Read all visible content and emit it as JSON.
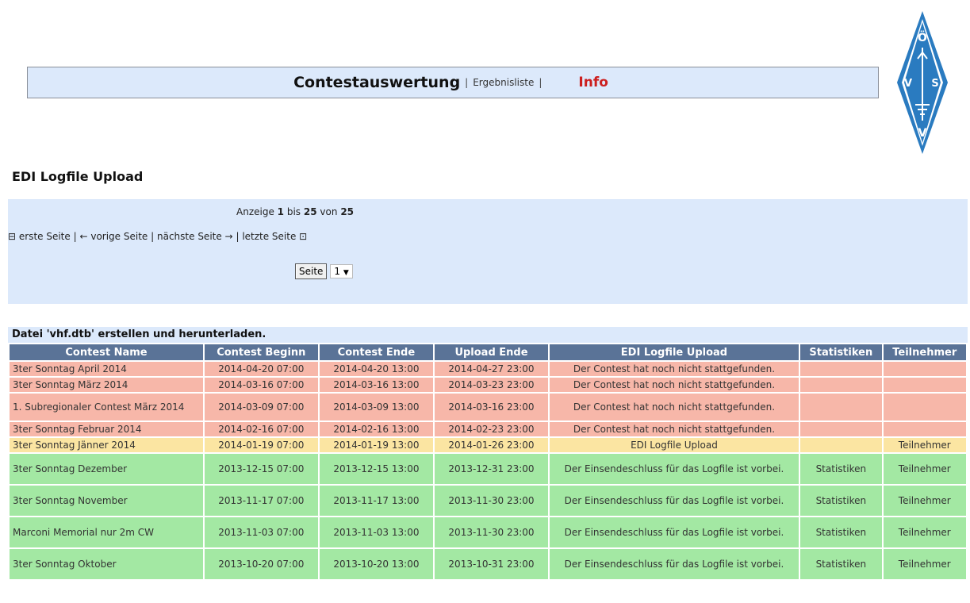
{
  "header": {
    "main": "Contestauswertung",
    "sep1": "|",
    "ergebnisliste": "Ergebnisliste",
    "sep2": "|",
    "info": "Info",
    "logo_text": "ÖVSV"
  },
  "page_title": "EDI Logfile Upload",
  "pager": {
    "anzeige": "Anzeige",
    "from": "1",
    "bis": "bis",
    "to": "25",
    "von": "von",
    "total": "25",
    "first": "⊟ erste Seite",
    "sep": "|",
    "prev": "← vorige Seite",
    "next": "nächste Seite →",
    "last": "letzte Seite ⊡",
    "seite_button": "Seite",
    "selected_page": "1",
    "dropdown_arrow": "▼"
  },
  "download_text": "Datei 'vhf.dtb' erstellen und herunterladen.",
  "table": {
    "headers": [
      "Contest Name",
      "Contest Beginn",
      "Contest Ende",
      "Upload Ende",
      "EDI Logfile Upload",
      "Statistiken",
      "Teilnehmer"
    ],
    "rows": [
      {
        "name": "3ter Sonntag April 2014",
        "beginn": "2014-04-20 07:00",
        "ende": "2014-04-20 13:00",
        "upload": "2014-04-27 23:00",
        "status": "Der Contest hat noch nicht stattgefunden.",
        "stat": "",
        "teil": ""
      },
      {
        "name": "3ter Sonntag März 2014",
        "beginn": "2014-03-16 07:00",
        "ende": "2014-03-16 13:00",
        "upload": "2014-03-23 23:00",
        "status": "Der Contest hat noch nicht stattgefunden.",
        "stat": "",
        "teil": ""
      },
      {
        "name": "1. Subregionaler Contest März 2014",
        "beginn": "2014-03-09 07:00",
        "ende": "2014-03-09 13:00",
        "upload": "2014-03-16 23:00",
        "status": "Der Contest hat noch nicht stattgefunden.",
        "stat": "",
        "teil": ""
      },
      {
        "name": "3ter Sonntag Februar 2014",
        "beginn": "2014-02-16 07:00",
        "ende": "2014-02-16 13:00",
        "upload": "2014-02-23 23:00",
        "status": "Der Contest hat noch nicht stattgefunden.",
        "stat": "",
        "teil": ""
      },
      {
        "name": "3ter Sonntag Jänner 2014",
        "beginn": "2014-01-19 07:00",
        "ende": "2014-01-19 13:00",
        "upload": "2014-01-26 23:00",
        "status": "EDI Logfile Upload",
        "stat": "",
        "teil": "Teilnehmer"
      },
      {
        "name": "3ter Sonntag Dezember",
        "beginn": "2013-12-15 07:00",
        "ende": "2013-12-15 13:00",
        "upload": "2013-12-31 23:00",
        "status": "Der Einsendeschluss für das Logfile ist vorbei.",
        "stat": "Statistiken",
        "teil": "Teilnehmer"
      },
      {
        "name": "3ter Sonntag November",
        "beginn": "2013-11-17 07:00",
        "ende": "2013-11-17 13:00",
        "upload": "2013-11-30 23:00",
        "status": "Der Einsendeschluss für das Logfile ist vorbei.",
        "stat": "Statistiken",
        "teil": "Teilnehmer"
      },
      {
        "name": "Marconi Memorial nur 2m CW",
        "beginn": "2013-11-03 07:00",
        "ende": "2013-11-03 13:00",
        "upload": "2013-11-30 23:00",
        "status": "Der Einsendeschluss für das Logfile ist vorbei.",
        "stat": "Statistiken",
        "teil": "Teilnehmer"
      },
      {
        "name": "3ter Sonntag Oktober",
        "beginn": "2013-10-20 07:00",
        "ende": "2013-10-20 13:00",
        "upload": "2013-10-31 23:00",
        "status": "Der Einsendeschluss für das Logfile ist vorbei.",
        "stat": "Statistiken",
        "teil": "Teilnehmer"
      }
    ]
  },
  "colors": {
    "nav_bg": "#dce9fb",
    "header_bg": "#5a7397",
    "row_future": "#f7b7a9",
    "row_open": "#fbe5a2",
    "row_closed": "#a3e8a3",
    "info_red": "#cc1f1f",
    "logo_blue": "#2a7bc0"
  }
}
